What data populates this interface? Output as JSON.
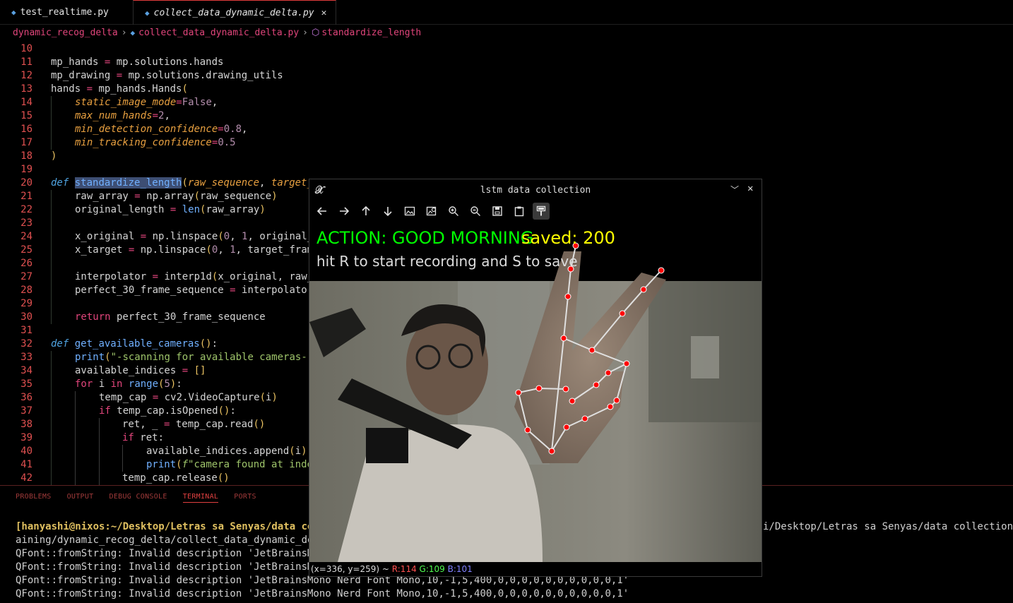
{
  "tabs": [
    {
      "label": "test_realtime.py"
    },
    {
      "label": "collect_data_dynamic_delta.py",
      "close": "✕"
    }
  ],
  "breadcrumb": {
    "folder": "dynamic_recog_delta",
    "file": "collect_data_dynamic_delta.py",
    "symbol": "standardize_length"
  },
  "editor": {
    "line_numbers": [
      "10",
      "11",
      "12",
      "13",
      "14",
      "15",
      "16",
      "17",
      "18",
      "19",
      "20",
      "21",
      "22",
      "23",
      "24",
      "25",
      "26",
      "27",
      "28",
      "29",
      "30",
      "31",
      "32",
      "33",
      "34",
      "35",
      "36",
      "37",
      "38",
      "39",
      "40",
      "41",
      "42"
    ]
  },
  "panel": {
    "tabs": [
      "PROBLEMS",
      "OUTPUT",
      "DEBUG CONSOLE",
      "TERMINAL",
      "PORTS"
    ],
    "active_tab": "TERMINAL",
    "terminal_lines": [
      "[hanyashi@nixos:~/Desktop/Letras sa Senyas/data coll",
      "aining/dynamic_recog_delta/collect_data_dynamic_delt",
      "QFont::fromString: Invalid description 'JetBrainsMon",
      "QFont::fromString: Invalid description 'JetBrainsMon",
      "QFont::fromString: Invalid description 'JetBrainsMono Nerd Font Mono,10,-1,5,400,0,0,0,0,0,0,0,0,0,0,1'",
      "QFont::fromString: Invalid description 'JetBrainsMono Nerd Font Mono,10,-1,5,400,0,0,0,0,0,0,0,0,0,0,1'"
    ],
    "terminal_right": "i/Desktop/Letras sa Senyas/data collection &"
  },
  "cv_window": {
    "title": "lstm data collection",
    "overlay_action": "ACTION: GOOD MORNING",
    "overlay_saved": "saved: 200",
    "overlay_hint": "hit R to start recording and S to save",
    "status_pos": "(x=336, y=259) ~ ",
    "status_r": "R:114",
    "status_g": "G:109",
    "status_b": "B:101",
    "colors": {
      "action": "#00ff00",
      "saved": "#ffff00",
      "hint": "#dcdcdc",
      "joint": "#ff0000",
      "bone": "#e0e0e0"
    }
  }
}
